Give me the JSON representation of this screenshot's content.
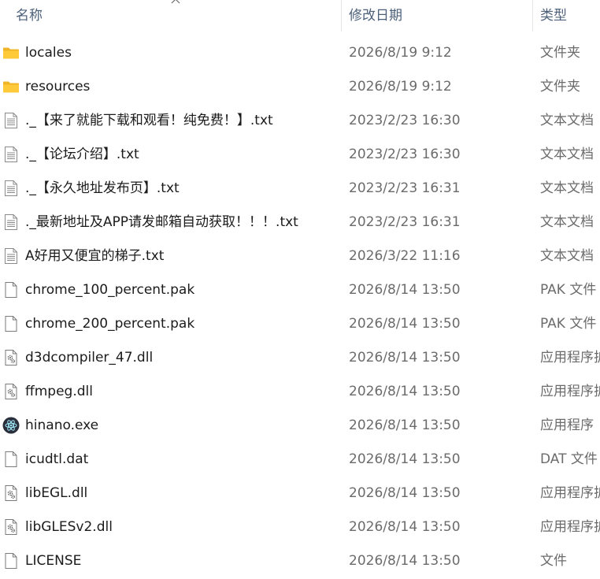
{
  "columns": {
    "name": "名称",
    "date": "修改日期",
    "type": "类型"
  },
  "sort": {
    "column": "name",
    "direction": "ascending"
  },
  "files": [
    {
      "name": "locales",
      "date": "2026/8/19 9:12",
      "type": "文件夹",
      "icon": "folder"
    },
    {
      "name": "resources",
      "date": "2026/8/19 9:12",
      "type": "文件夹",
      "icon": "folder"
    },
    {
      "name": "._【来了就能下载和观看！纯免费！】.txt",
      "date": "2023/2/23 16:30",
      "type": "文本文档",
      "icon": "text"
    },
    {
      "name": "._【论坛介绍】.txt",
      "date": "2023/2/23 16:30",
      "type": "文本文档",
      "icon": "text"
    },
    {
      "name": "._【永久地址发布页】.txt",
      "date": "2023/2/23 16:31",
      "type": "文本文档",
      "icon": "text"
    },
    {
      "name": "._最新地址及APP请发邮箱自动获取！！！.txt",
      "date": "2023/2/23 16:31",
      "type": "文本文档",
      "icon": "text"
    },
    {
      "name": "A好用又便宜的梯子.txt",
      "date": "2026/3/22 11:16",
      "type": "文本文档",
      "icon": "text"
    },
    {
      "name": "chrome_100_percent.pak",
      "date": "2026/8/14 13:50",
      "type": "PAK 文件",
      "icon": "file"
    },
    {
      "name": "chrome_200_percent.pak",
      "date": "2026/8/14 13:50",
      "type": "PAK 文件",
      "icon": "file"
    },
    {
      "name": "d3dcompiler_47.dll",
      "date": "2026/8/14 13:50",
      "type": "应用程序扩",
      "icon": "dll"
    },
    {
      "name": "ffmpeg.dll",
      "date": "2026/8/14 13:50",
      "type": "应用程序扩",
      "icon": "dll"
    },
    {
      "name": "hinano.exe",
      "date": "2026/8/14 13:50",
      "type": "应用程序",
      "icon": "exe"
    },
    {
      "name": "icudtl.dat",
      "date": "2026/8/14 13:50",
      "type": "DAT 文件",
      "icon": "file"
    },
    {
      "name": "libEGL.dll",
      "date": "2026/8/14 13:50",
      "type": "应用程序扩",
      "icon": "dll"
    },
    {
      "name": "libGLESv2.dll",
      "date": "2026/8/14 13:50",
      "type": "应用程序扩",
      "icon": "dll"
    },
    {
      "name": "LICENSE",
      "date": "2026/8/14 13:50",
      "type": "文件",
      "icon": "file"
    }
  ]
}
